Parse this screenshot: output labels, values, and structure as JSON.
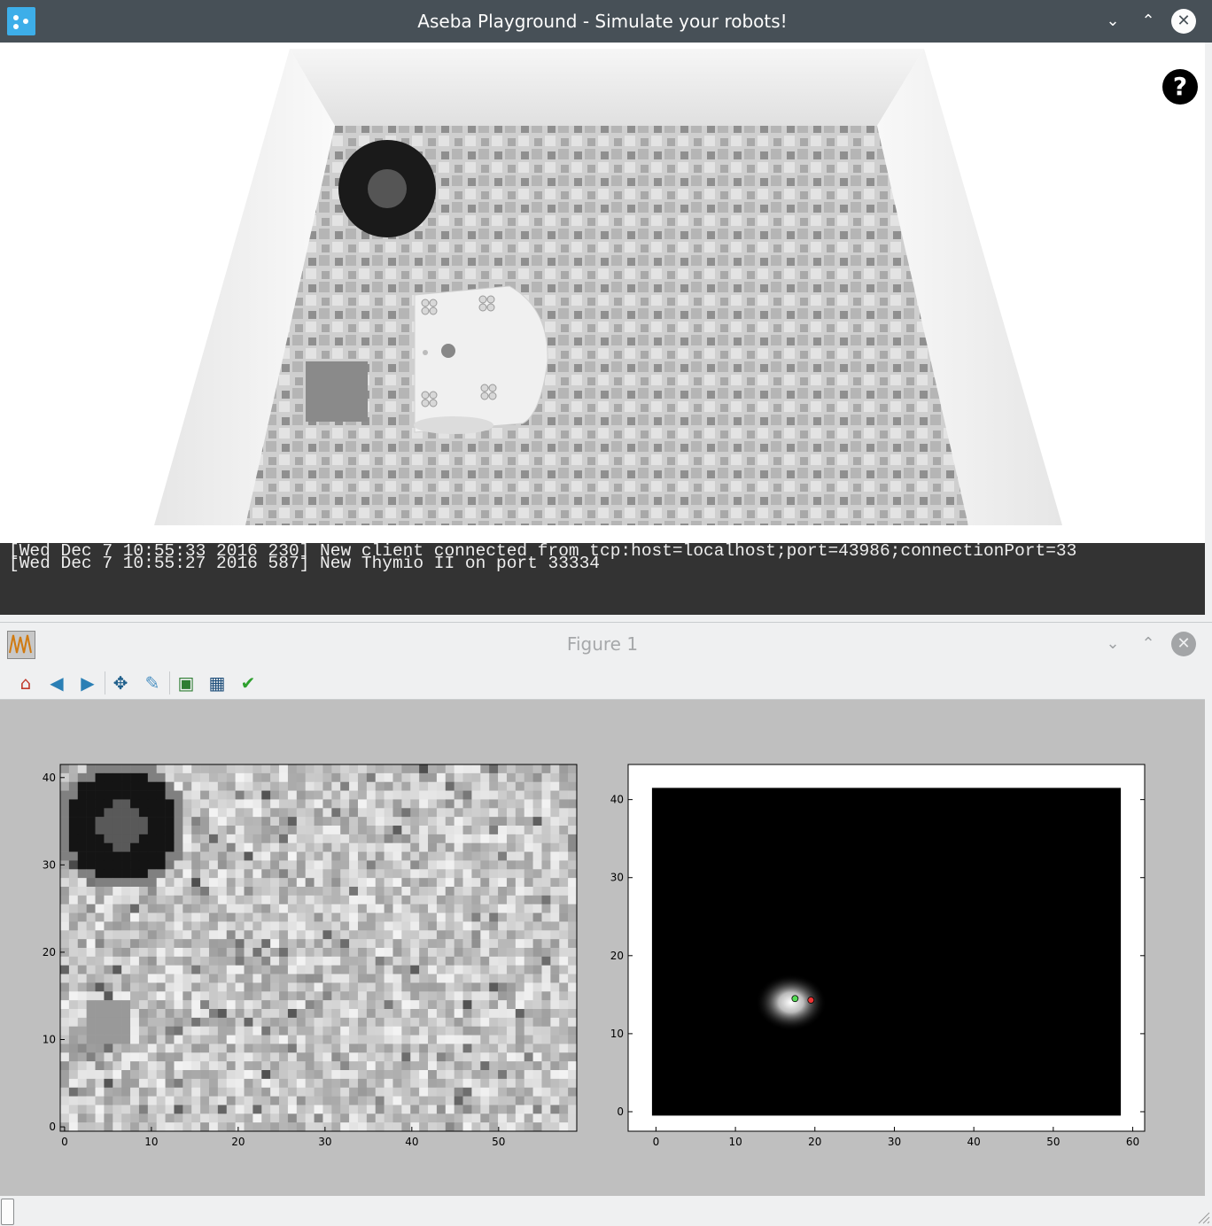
{
  "window1": {
    "title": "Aseba Playground - Simulate your robots!",
    "icon": "aseba-icon",
    "help_label": "?",
    "buttons": {
      "minimize": "minimize-icon",
      "maximize": "maximize-icon",
      "close": "close-icon"
    }
  },
  "console": {
    "lines": [
      "[Wed Dec  7 10:55:33 2016 230] New client connected from tcp:host=localhost;port=43986;connectionPort=33",
      "[Wed Dec  7 10:55:27 2016 587] New Thymio II on port 33334"
    ]
  },
  "window2": {
    "title": "Figure 1",
    "icon": "matplotlib-figure-icon",
    "toolbar": [
      "home-icon",
      "back-icon",
      "forward-icon",
      "pan-icon",
      "zoom-icon",
      "subplots-icon",
      "save-icon",
      "customize-icon"
    ]
  },
  "colors": {
    "titlebar": "#475057",
    "console_bg": "#333333",
    "figure_bg": "#bfbfbf",
    "estimate_point": "#55dd55",
    "true_point": "#ee3333"
  },
  "chart_data": [
    {
      "type": "heatmap",
      "title": "",
      "x_ticks": [
        "0",
        "10",
        "20",
        "30",
        "40",
        "50"
      ],
      "y_ticks": [
        "0",
        "10",
        "20",
        "30",
        "40"
      ],
      "xlim": [
        -0.5,
        59
      ],
      "ylim": [
        -0.5,
        41.5
      ],
      "colormap": "gray",
      "description_of_content": "grayscale ground map"
    },
    {
      "type": "heatmap",
      "title": "",
      "x_ticks": [
        "0",
        "10",
        "20",
        "30",
        "40",
        "50",
        "60"
      ],
      "y_ticks": [
        "0",
        "10",
        "20",
        "30",
        "40"
      ],
      "xlim": [
        -3.5,
        61.5
      ],
      "ylim": [
        -2.5,
        44.5
      ],
      "colormap": "gray",
      "blob_center": [
        17,
        14
      ],
      "points": [
        {
          "x": 17.5,
          "y": 14.5,
          "color": "#55dd55"
        },
        {
          "x": 19.5,
          "y": 14.3,
          "color": "#ee3333"
        }
      ]
    }
  ]
}
